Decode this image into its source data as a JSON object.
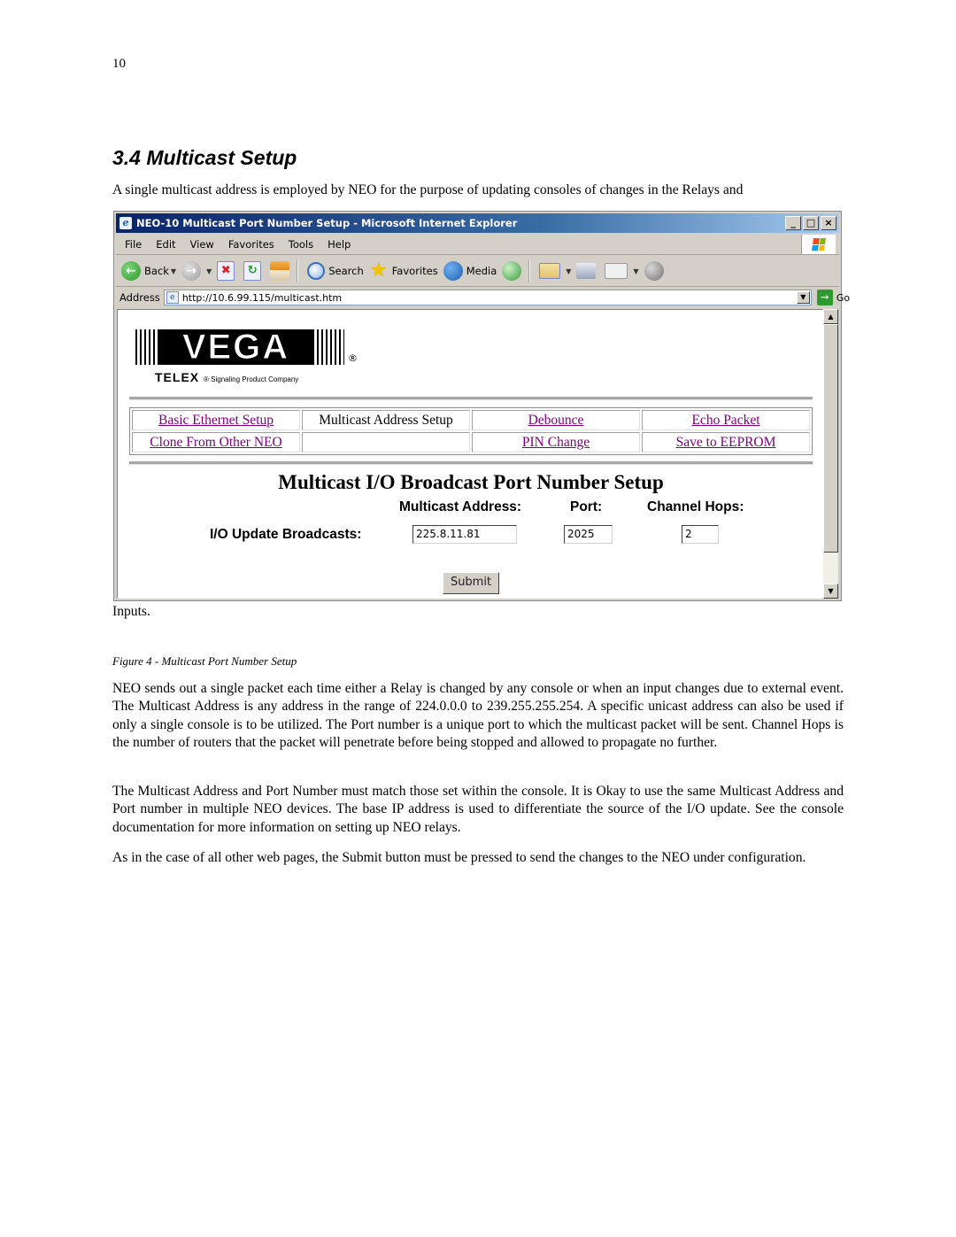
{
  "page_number": "10",
  "section_heading": "3.4  Multicast Setup",
  "intro_text": "A single multicast address is employed by NEO for the purpose of updating consoles of changes in the Relays and",
  "browser": {
    "title": "NEO-10 Multicast Port Number Setup - Microsoft Internet Explorer",
    "window_buttons": {
      "minimize": "_",
      "maximize": "□",
      "close": "×"
    },
    "menu": [
      "File",
      "Edit",
      "View",
      "Favorites",
      "Tools",
      "Help"
    ],
    "toolbar": {
      "back": "Back",
      "search": "Search",
      "favorites": "Favorites",
      "media": "Media"
    },
    "address_label": "Address",
    "address_url": "http://10.6.99.115/multicast.htm",
    "go_label": "Go"
  },
  "webpage": {
    "logo_text": "VEGA",
    "logo_registered": "®",
    "logo_company": "TELEX",
    "logo_tagline": "® Signaling Product Company",
    "nav": [
      [
        {
          "label": "Basic Ethernet Setup",
          "link": true
        },
        {
          "label": "Multicast Address Setup",
          "link": false
        },
        {
          "label": "Debounce",
          "link": true
        },
        {
          "label": "Echo Packet",
          "link": true
        }
      ],
      [
        {
          "label": "Clone From Other NEO",
          "link": true
        },
        {
          "label": "",
          "link": false
        },
        {
          "label": "PIN Change",
          "link": true
        },
        {
          "label": "Save to EEPROM",
          "link": true
        }
      ]
    ],
    "form_title": "Multicast I/O Broadcast Port Number Setup",
    "columns": {
      "address": "Multicast Address:",
      "port": "Port:",
      "hops": "Channel Hops:"
    },
    "row_label": "I/O Update Broadcasts:",
    "values": {
      "address": "225.8.11.81",
      "port": "2025",
      "hops": "2"
    },
    "submit_label": "Submit"
  },
  "inputs_text": "Inputs.",
  "caption": "Figure 4 - Multicast Port Number Setup",
  "paragraphs": [
    "NEO sends out a single packet each time either a Relay is changed by any console or when an input changes due to external event.  The Multicast Address is any address in the range of 224.0.0.0 to 239.255.255.254.  A specific unicast address can also be used if only a single console is to be utilized.  The Port number is a unique port to which the multicast packet will be sent.  Channel Hops is the number of routers that the packet will penetrate before being stopped and allowed to propagate no further.",
    "The Multicast Address and Port Number must match those set within the console.  It is Okay to use the same Multicast Address and Port number in multiple NEO devices.  The base IP address is used to differentiate the source of the I/O update.  See the console documentation for more information on setting up NEO relays.",
    "As in the case of all other web pages, the Submit button must be pressed to send the changes to the NEO under configuration."
  ]
}
